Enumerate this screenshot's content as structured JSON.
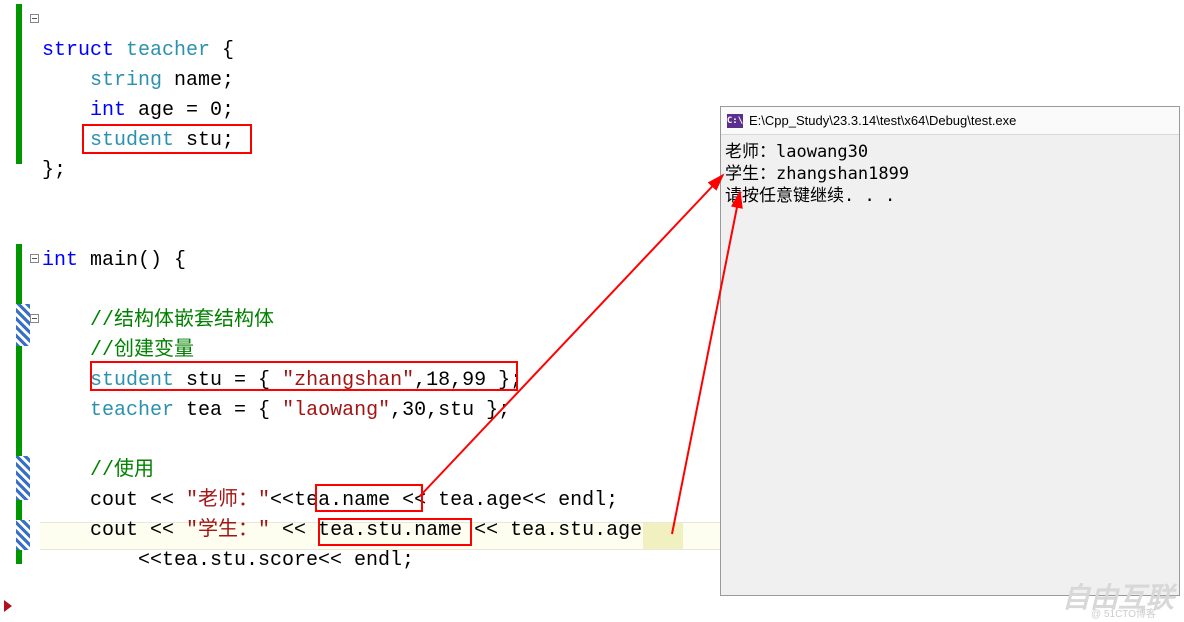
{
  "code": {
    "line1_struct": "struct",
    "line1_teacher": "teacher",
    "line1_brace": " {",
    "line2_string": "string",
    "line2_name": " name;",
    "line3_int": "int",
    "line3_age": " age = 0;",
    "line4_student": "student",
    "line4_stu": " stu;",
    "line5": "};",
    "line7_int": "int",
    "line7_main": " main() {",
    "cmt1": "//结构体嵌套结构体",
    "cmt2": "//创建变量",
    "line10_student": "student",
    "line10_stu": " stu = { ",
    "line10_str": "\"zhangshan\"",
    "line10_rest": ",18,99 }",
    "line10_semi": ";",
    "line11_teacher": "teacher",
    "line11_tea": " tea = { ",
    "line11_str": "\"laowang\"",
    "line11_rest": ",30,stu };",
    "cmt3": "//使用",
    "line13a": "cout << ",
    "line13_str": "\"老师：\"",
    "line13b": "<<",
    "line13c": "tea.name",
    "line13d": " << tea.age<< endl;",
    "line14a": "cout << ",
    "line14_str": "\"学生：\"",
    "line14b": " << ",
    "line14c": "tea.stu.name",
    "line14d": " << tea.stu.",
    "line14e": "age",
    "line15": "<<tea.stu.score<< endl;"
  },
  "console": {
    "icon": "C:\\",
    "title": "E:\\Cpp_Study\\23.3.14\\test\\x64\\Debug\\test.exe",
    "line1": "老师：laowang30",
    "line2": "学生：zhangshan1899",
    "line3": "请按任意键继续. . ."
  },
  "watermark": "自由互联",
  "watermark_sub": "@ 51CTO博客"
}
